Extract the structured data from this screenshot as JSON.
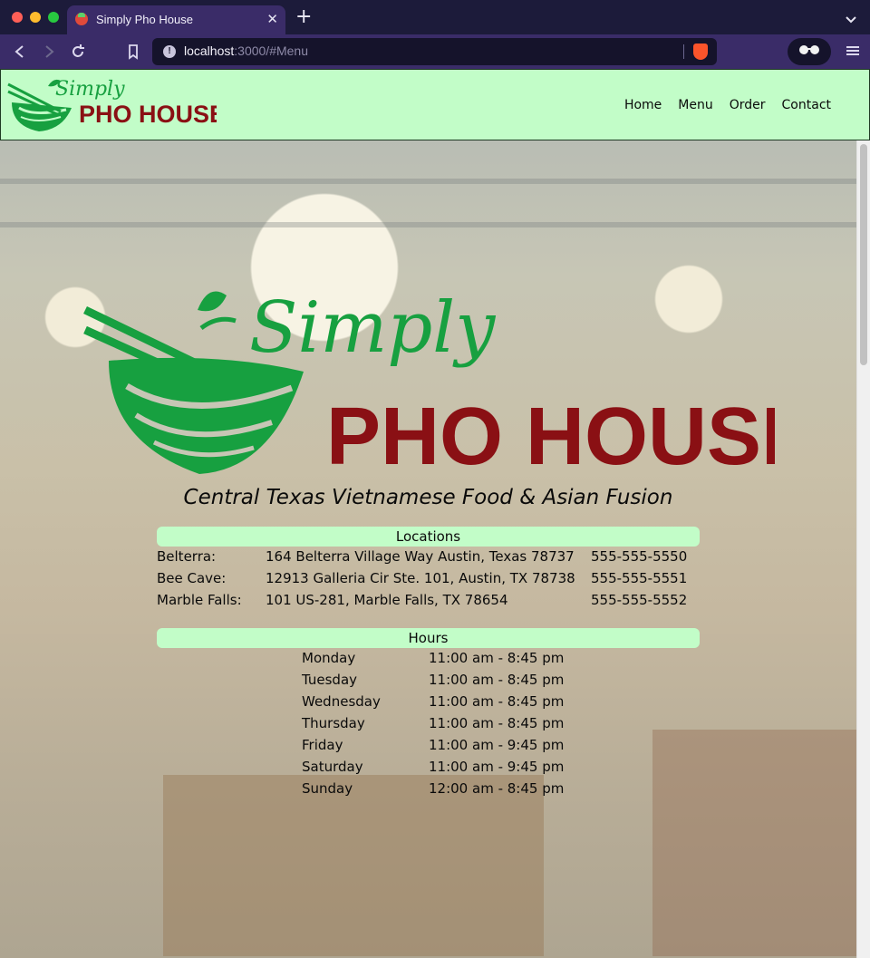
{
  "browser": {
    "tab_title": "Simply Pho House",
    "tab_close": "✕",
    "new_tab": "+",
    "url_host": "localhost",
    "url_rest": ":3000/#Menu"
  },
  "nav": {
    "logo": {
      "script": "Simply",
      "name": "PHO HOUSE"
    },
    "links": [
      "Home",
      "Menu",
      "Order",
      "Contact"
    ]
  },
  "hero": {
    "logo": {
      "script": "Simply",
      "name": "PHO HOUSE"
    },
    "tagline": "Central Texas Vietnamese Food & Asian Fusion"
  },
  "locations": {
    "header": "Locations",
    "rows": [
      {
        "name": "Belterra:",
        "address": "164 Belterra Village Way Austin, Texas 78737",
        "phone": "555-555-5550"
      },
      {
        "name": "Bee Cave:",
        "address": "12913 Galleria Cir Ste. 101, Austin, TX 78738",
        "phone": "555-555-5551"
      },
      {
        "name": "Marble Falls:",
        "address": "101 US-281, Marble Falls, TX 78654",
        "phone": "555-555-5552"
      }
    ]
  },
  "hours": {
    "header": "Hours",
    "rows": [
      {
        "day": "Monday",
        "time": "11:00 am - 8:45 pm"
      },
      {
        "day": "Tuesday",
        "time": "11:00 am - 8:45 pm"
      },
      {
        "day": "Wednesday",
        "time": "11:00 am - 8:45 pm"
      },
      {
        "day": "Thursday",
        "time": "11:00 am - 8:45 pm"
      },
      {
        "day": "Friday",
        "time": "11:00 am - 9:45 pm"
      },
      {
        "day": "Saturday",
        "time": "11:00 am - 9:45 pm"
      },
      {
        "day": "Sunday",
        "time": "12:00 am - 8:45 pm"
      }
    ]
  },
  "colors": {
    "nav_bg": "#c2fdc8",
    "logo_green": "#17a040",
    "logo_red": "#8a1014",
    "chrome_bg": "#3a2c68"
  }
}
